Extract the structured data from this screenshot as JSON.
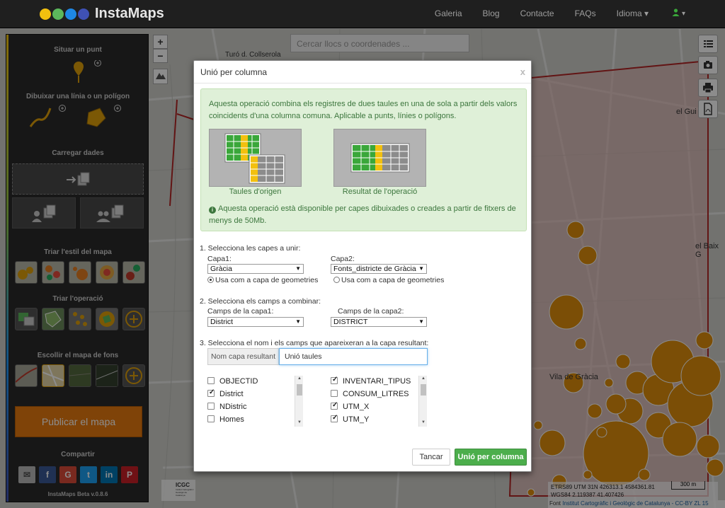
{
  "navbar": {
    "brand": "InstaMaps",
    "logo_colors": [
      "#f2c00f",
      "#5cb85c",
      "#1e88e5",
      "#3f51b5"
    ],
    "items": [
      "Galeria",
      "Blog",
      "Contacte",
      "FAQs",
      "Idioma ▾"
    ],
    "user_icon": "user-icon",
    "user_caret": "▾"
  },
  "sidebar": {
    "situar": "Situar un punt",
    "dibuixar": "Dibuixar una línia o un polígon",
    "carregar": "Carregar dades",
    "triar_estil": "Triar l'estil del mapa",
    "triar_operacio": "Triar l'operació",
    "escollir_fons": "Escollir el mapa de fons",
    "publicar": "Publicar el mapa",
    "compartir": "Compartir",
    "version": "InstaMaps Beta v.0.8.6",
    "share_buttons": [
      "✉",
      "f",
      "G",
      "t",
      "in",
      "P"
    ]
  },
  "map": {
    "search_placeholder": "Cercar llocs o coordenades ...",
    "zoom_in": "+",
    "zoom_out": "−",
    "label_turo": "Turó d. Collserola",
    "label_gui": "el Gui",
    "label_baix": "el Baix G",
    "label_vila": "Vila de Gràcia",
    "coords_line1": "ETRS89 UTM 31N 426313.1 4584361.81",
    "coords_line2": "WGS84 2.119387 41.407426",
    "scale": "300 m",
    "attrib_prefix": "Font",
    "attrib_link": "Institut Cartogràfic i Geològic de Catalunya",
    "attrib_suffix": "- CC-BY ZL 15",
    "icgc": "ICGC",
    "icgc_sub": "Institut Cartogràfic i Geològic de Catalunya"
  },
  "modal": {
    "title": "Unió per columna",
    "close": "x",
    "info_text": "Aquesta operació combina els registres de dues taules en una de sola a partir dels valors coincidents d'una columna comuna. Aplicable a punts, línies o polígons.",
    "caption_origen": "Taules d'origen",
    "caption_resultat": "Resultat de l'operació",
    "info_note": "Aquesta operació està disponible per capes dibuixades o creades a partir de fitxers de menys de 50Mb.",
    "step1": "1. Selecciona les capes a unir:",
    "capa1_label": "Capa1:",
    "capa1_value": "Gràcia",
    "capa2_label": "Capa2:",
    "capa2_value": "Fonts_districte de Gràcia",
    "radio_label": "Usa com a capa de geometries",
    "step2": "2. Selecciona els camps a combinar:",
    "camps1_label": "Camps de la capa1:",
    "camps1_value": "District",
    "camps2_label": "Camps de la capa2:",
    "camps2_value": "DISTRICT",
    "step3": "3. Selecciona el nom i els camps que apareixeran a la capa resultant:",
    "nom_label": "Nom capa resultant",
    "nom_value": "Unió taules",
    "fields_left": [
      {
        "label": "OBJECTID",
        "checked": false
      },
      {
        "label": "District",
        "checked": true
      },
      {
        "label": "NDistric",
        "checked": false
      },
      {
        "label": "Homes",
        "checked": false
      }
    ],
    "fields_right": [
      {
        "label": "INVENTARI_TIPUS",
        "checked": true
      },
      {
        "label": "CONSUM_LITRES",
        "checked": false
      },
      {
        "label": "UTM_X",
        "checked": true
      },
      {
        "label": "UTM_Y",
        "checked": true
      }
    ],
    "cancel": "Tancar",
    "submit": "Unió per columna"
  }
}
